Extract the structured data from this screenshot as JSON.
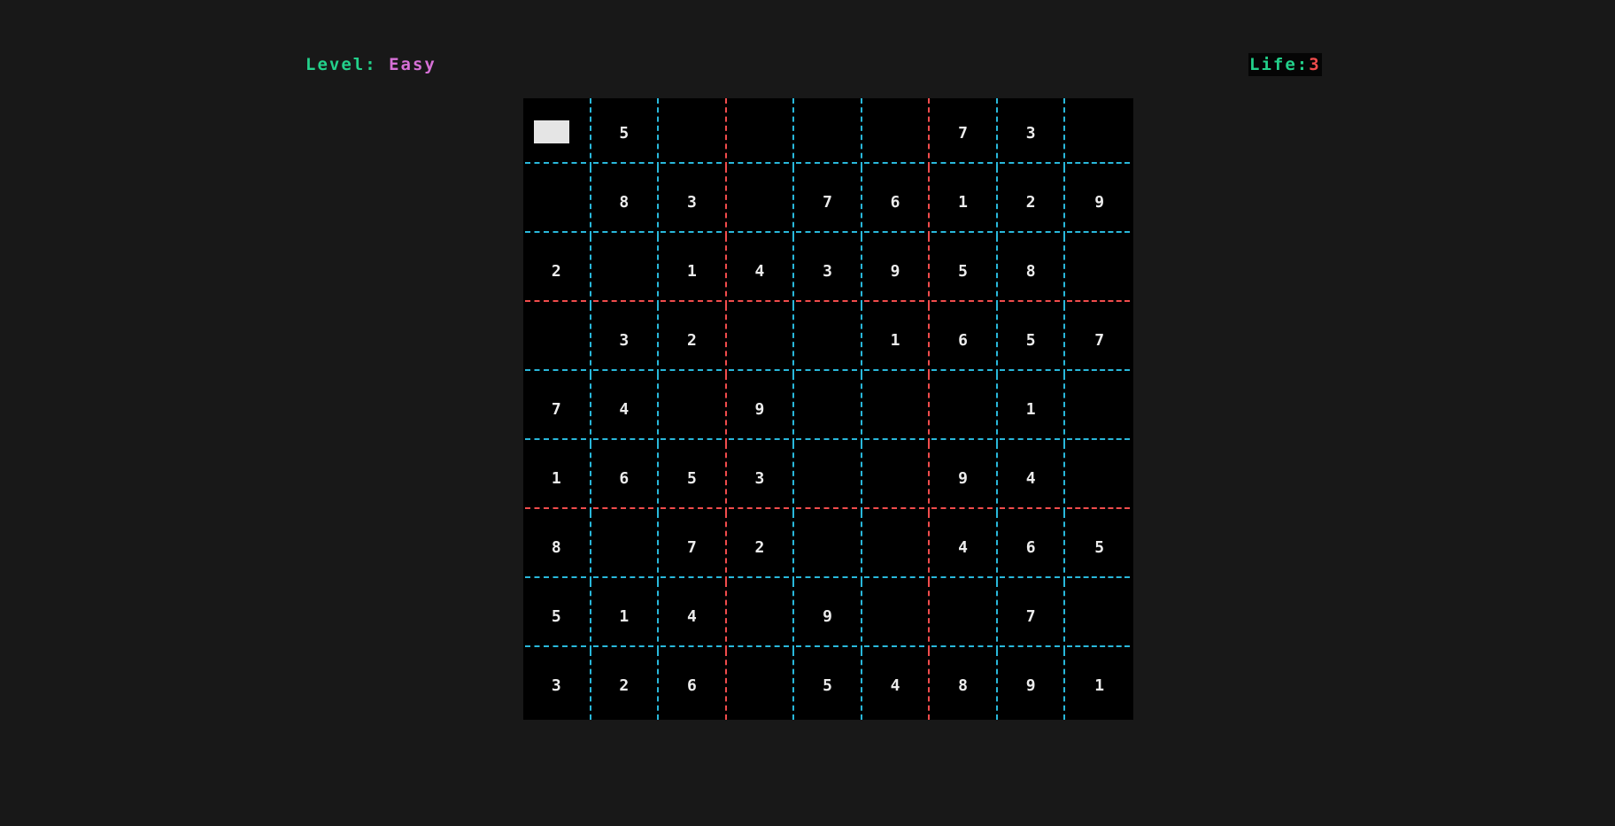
{
  "header": {
    "level_label": "Level:",
    "level_value": "Easy",
    "life_label": "Life:",
    "life_value": "3"
  },
  "colors": {
    "background": "#181818",
    "board": "#000000",
    "label_green": "#23d18b",
    "level_magenta": "#d670d6",
    "life_red": "#f14c4c",
    "grid_cyan": "#29b8db",
    "box_border_red": "#f14c4c",
    "digit": "#ececec",
    "cursor": "#e5e5e5"
  },
  "board": {
    "selected_cell": [
      0,
      0
    ],
    "rows": [
      [
        "",
        "5",
        "",
        "",
        "",
        "",
        "7",
        "3",
        ""
      ],
      [
        "",
        "8",
        "3",
        "",
        "7",
        "6",
        "1",
        "2",
        "9"
      ],
      [
        "2",
        "",
        "1",
        "4",
        "3",
        "9",
        "5",
        "8",
        ""
      ],
      [
        "",
        "3",
        "2",
        "",
        "",
        "1",
        "6",
        "5",
        "7"
      ],
      [
        "7",
        "4",
        "",
        "9",
        "",
        "",
        "",
        "1",
        ""
      ],
      [
        "1",
        "6",
        "5",
        "3",
        "",
        "",
        "9",
        "4",
        ""
      ],
      [
        "8",
        "",
        "7",
        "2",
        "",
        "",
        "4",
        "6",
        "5"
      ],
      [
        "5",
        "1",
        "4",
        "",
        "9",
        "",
        "",
        "7",
        ""
      ],
      [
        "3",
        "2",
        "6",
        "",
        "5",
        "4",
        "8",
        "9",
        "1"
      ]
    ]
  }
}
